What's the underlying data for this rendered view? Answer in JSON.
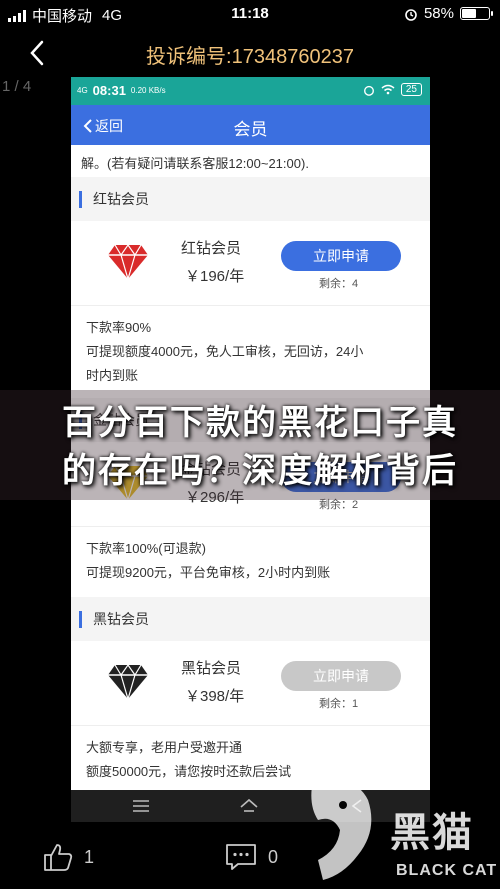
{
  "status_bar": {
    "carrier": "中国移动",
    "network": "4G",
    "time": "11:18",
    "battery": "58%",
    "battery_level": 0.58
  },
  "nav": {
    "title": "投诉编号:17348760237",
    "page_counter": "1 / 4"
  },
  "inner": {
    "status": {
      "network": "4G",
      "time": "08:31",
      "speed": "0.20 KB/s",
      "battery": "25"
    },
    "header": {
      "back_label": "返回",
      "title": "会员"
    },
    "note": "解。(若有疑问请联系客服12:00~21:00).",
    "sections": [
      {
        "title": "红钻会员",
        "name": "红钻会员",
        "price": "￥196/年",
        "button": "立即申请",
        "remaining": "剩余：4",
        "desc": [
          "下款率90%",
          "可提现额度4000元，免人工审核，无回访，24小",
          "时内到账"
        ],
        "gem_color": "#d92b2b",
        "button_color": "#3b6fe0"
      },
      {
        "title": "金钻会员",
        "name": "金钻会员",
        "price": "￥296/年",
        "button": "立即申请",
        "remaining": "剩余：2",
        "desc": [
          "下款率100%(可退款)",
          "可提现9200元，平台免审核，2小时内到账"
        ],
        "gem_color": "#e8c02a",
        "button_color": "#3b6fe0"
      },
      {
        "title": "黑钻会员",
        "name": "黑钻会员",
        "price": "￥398/年",
        "button": "立即申请",
        "remaining": "剩余：1",
        "desc": [
          "大额专享，老用户受邀开通",
          "额度50000元，请您按时还款后尝试"
        ],
        "gem_color": "#222222",
        "button_color": "#c8c8c8"
      }
    ]
  },
  "overlay": {
    "line1": "百分百下款的黑花口子真",
    "line2": "的存在吗？深度解析背后"
  },
  "bottom": {
    "likes": "1",
    "comments": "0"
  },
  "watermark": {
    "cn": "黑猫",
    "en": "BLACK CAT"
  }
}
